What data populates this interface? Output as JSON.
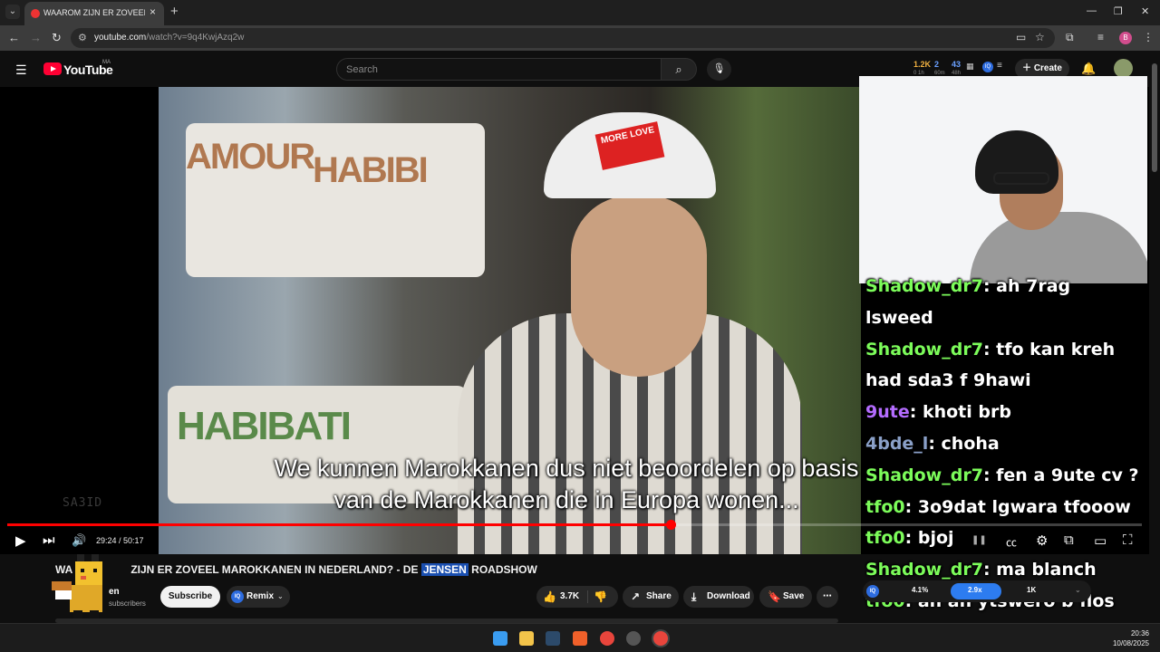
{
  "browser": {
    "tab_title": "WAAROM ZIJN ER ZOVEEL MA",
    "url_host": "youtube.com",
    "url_path": "/watch?v=9q4KwjAzq2w",
    "profile_initial": "B"
  },
  "youtube": {
    "logo_text": "YouTube",
    "country_code": "MA",
    "search_placeholder": "Search",
    "create_label": "Create",
    "ext_stats": {
      "views": "1.2K",
      "views_sub": "0 1h",
      "count2": "2",
      "count2_sub": "60m",
      "count3": "43",
      "count3_sub": "48h"
    }
  },
  "player": {
    "subtitle_line1": "We kunnen Marokkanen dus niet beoordelen op basis",
    "subtitle_line2": "van de Marokkanen die in Europa wonen...",
    "current_time": "29:24",
    "duration": "50:17",
    "time_display": "29:24 / 50:17",
    "progress": 0.585,
    "watermark": "SA3ID",
    "scarf_texts": [
      "AMOUR",
      "HABIBI",
      "HABIBATI"
    ],
    "cap_text": "MORE LOVE"
  },
  "chat": [
    {
      "user": "Shadow_dr7",
      "color": "#7cfc5a",
      "message": "ah 7rag"
    },
    {
      "user": "",
      "color": "#ffffff",
      "message": "lsweed"
    },
    {
      "user": "Shadow_dr7",
      "color": "#7cfc5a",
      "message": "tfo kan kreh"
    },
    {
      "user": "",
      "color": "#ffffff",
      "message": "had sda3 f 9hawi"
    },
    {
      "user": "9ute",
      "color": "#b46cff",
      "message": "khoti brb"
    },
    {
      "user": "4bde_l",
      "color": "#8aa0c8",
      "message": "choha"
    },
    {
      "user": "Shadow_dr7",
      "color": "#7cfc5a",
      "message": "fen a 9ute cv ?"
    },
    {
      "user": "tfo0",
      "color": "#7cfc5a",
      "message": "3o9dat lgwara tfooow"
    },
    {
      "user": "tfo0",
      "color": "#7cfc5a",
      "message": "bjoj"
    },
    {
      "user": "Shadow_dr7",
      "color": "#7cfc5a",
      "message": "ma blanch"
    },
    {
      "user": "tfo0",
      "color": "#7cfc5a",
      "message": "ah ah ytswero b flos"
    }
  ],
  "video": {
    "title_pre": "WA",
    "title_mid": "ZIJN ER ZOVEEL MAROKKANEN IN NEDERLAND? - DE ",
    "title_highlight": "JENSEN",
    "title_post": " ROADSHOW",
    "channel_name": "en",
    "subscribers": "subscribers",
    "subscribe_label": "Subscribe",
    "remix_label": "Remix",
    "like_count": "3.7K",
    "share_label": "Share",
    "download_label": "Download",
    "save_label": "Save"
  },
  "speed_control": {
    "left": "4.1%",
    "active": "2.9x",
    "right": "1K"
  },
  "taskbar": {
    "time": "20:36",
    "date": "10/08/2025"
  },
  "colors": {
    "accent_red": "#ff0000",
    "chat_green": "#7cfc5a",
    "highlight_blue": "#1a4fb0"
  }
}
